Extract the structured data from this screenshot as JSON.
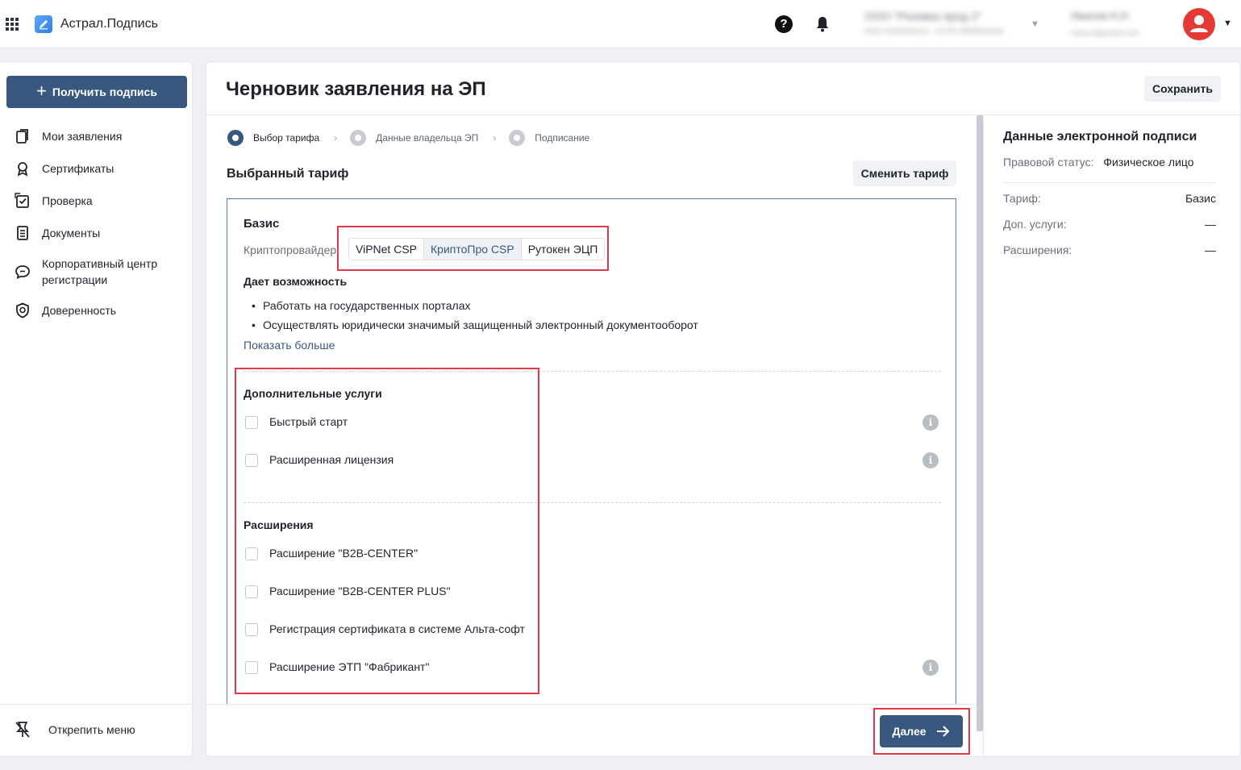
{
  "app": {
    "title": "Астрал.Подпись"
  },
  "header": {
    "org_name": "ООО \"Розовка прод 2\"",
    "org_details": "ИНН 5045693114 · ОГРН 9958081581",
    "user_name": "Иванов И.И.",
    "user_email": "ivanov@gmail.com"
  },
  "sidebar": {
    "primary_button": "Получить подпись",
    "items": [
      {
        "label": "Мои заявления",
        "icon": "documents-icon"
      },
      {
        "label": "Сертификаты",
        "icon": "award-icon"
      },
      {
        "label": "Проверка",
        "icon": "check-square-icon"
      },
      {
        "label": "Документы",
        "icon": "file-list-icon"
      },
      {
        "label": "Корпоративный центр регистрации",
        "icon": "chat-icon"
      },
      {
        "label": "Доверенность",
        "icon": "shield-icon"
      }
    ],
    "unpin_label": "Открепить меню"
  },
  "page": {
    "title": "Черновик заявления на ЭП",
    "save_label": "Сохранить",
    "steps": [
      {
        "label": "Выбор тарифа",
        "state": "active"
      },
      {
        "label": "Данные владельца ЭП",
        "state": "todo"
      },
      {
        "label": "Подписание",
        "state": "todo"
      }
    ],
    "selected_tariff_title": "Выбранный тариф",
    "change_tariff_label": "Сменить тариф",
    "next_label": "Далее"
  },
  "tariff": {
    "name": "Базис",
    "crypto_label": "Криптопровайдер",
    "crypto_options": [
      "ViPNet CSP",
      "КриптоПро CSP",
      "Рутокен ЭЦП"
    ],
    "crypto_selected": "КриптоПро CSP",
    "gives_title": "Дает возможность",
    "gives": [
      "Работать на государственных порталах",
      "Осуществлять юридически значимый защищенный электронный документооборот"
    ],
    "show_more": "Показать больше",
    "extra_services_title": "Дополнительные услуги",
    "extra_services": [
      {
        "label": "Быстрый старт",
        "checked": false,
        "info": true
      },
      {
        "label": "Расширенная лицензия",
        "checked": false,
        "info": true
      }
    ],
    "extensions_title": "Расширения",
    "extensions": [
      {
        "label": "Расширение \"B2B-CENTER\"",
        "checked": false,
        "info": false
      },
      {
        "label": "Расширение \"B2B-CENTER PLUS\"",
        "checked": false,
        "info": false
      },
      {
        "label": "Регистрация сертификата в системе Альта-софт",
        "checked": false,
        "info": false
      },
      {
        "label": "Расширение ЭТП \"Фабрикант\"",
        "checked": false,
        "info": true
      }
    ]
  },
  "summary": {
    "title": "Данные электронной подписи",
    "legal_status_label": "Правовой статус:",
    "legal_status_value": "Физическое лицо",
    "rows": [
      {
        "label": "Тариф:",
        "value": "Базис"
      },
      {
        "label": "Доп. услуги:",
        "value": "—"
      },
      {
        "label": "Расширения:",
        "value": "—"
      }
    ]
  },
  "colors": {
    "primary": "#38587f",
    "annotation": "#e53946",
    "avatar": "#e53935"
  }
}
